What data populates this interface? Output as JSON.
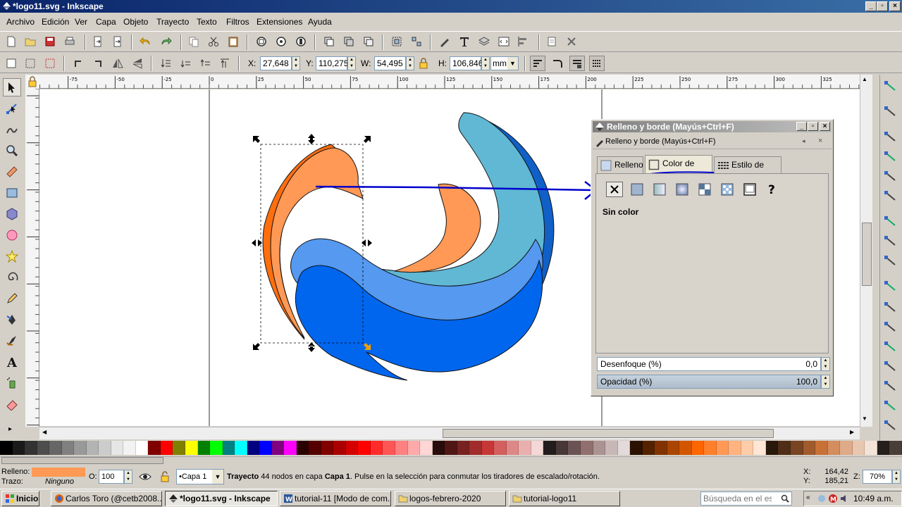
{
  "window": {
    "title": "*logo11.svg - Inkscape",
    "min": "_",
    "max": "▫",
    "close": "×"
  },
  "menu": [
    "Archivo",
    "Edición",
    "Ver",
    "Capa",
    "Objeto",
    "Trayecto",
    "Texto",
    "Filtros",
    "Extensiones",
    "Ayuda"
  ],
  "selector_toolbar": {
    "x_label": "X:",
    "x_value": "27,648",
    "y_label": "Y:",
    "y_value": "110,275",
    "w_label": "W:",
    "w_value": "54,495",
    "h_label": "H:",
    "h_value": "106,846",
    "unit": "mm"
  },
  "ruler_labels": [
    "-75",
    "-50",
    "-25",
    "0",
    "25",
    "50",
    "75",
    "100",
    "125",
    "150",
    "175",
    "200",
    "225",
    "250",
    "275",
    "300",
    "325"
  ],
  "dialog": {
    "title": "Relleno y borde (Mayús+Ctrl+F)",
    "subtitle": "Relleno y borde (Mayús+Ctrl+F)",
    "tabs": [
      "Relleno",
      "Color de trazo",
      "Estilo de trazo"
    ],
    "active_tab": "Color de trazo",
    "paint_mode_label": "Sin color",
    "blur_label": "Desenfoque (%)",
    "blur_value": "0,0",
    "opacity_label": "Opacidad (%)",
    "opacity_value": "100,0"
  },
  "status": {
    "fill_label": "Relleno:",
    "fill_color": "#ff9955",
    "stroke_label": "Trazo:",
    "stroke_value": "Ninguno",
    "opacity_label": "O:",
    "opacity_value": "100",
    "layer": "•Capa 1",
    "message_bold": "Trayecto",
    "message": " 44 nodos en capa ",
    "message_layer": "Capa 1",
    "message_tail": ". Pulse en la selección para conmutar los tiradores de escalado/rotación.",
    "x_label": "X:",
    "x_value": "164,42",
    "y_label": "Y:",
    "y_value": "185,21",
    "z_label": "Z:",
    "zoom": "70%"
  },
  "taskbar": {
    "start": "Inicio",
    "tasks": [
      "Carlos Toro (@cetb2008...",
      "*logo11.svg - Inkscape",
      "tutorial-11 [Modo de com...",
      "logos-febrero-2020",
      "tutorial-logo11"
    ],
    "search_placeholder": "Búsqueda en el escrito",
    "clock": "10:49 a.m."
  },
  "palette": [
    "#000000",
    "#1a1a1a",
    "#333333",
    "#4d4d4d",
    "#666666",
    "#808080",
    "#999999",
    "#b3b3b3",
    "#cccccc",
    "#e6e6e6",
    "#f2f2f2",
    "#ffffff",
    "#800000",
    "#ff0000",
    "#808000",
    "#ffff00",
    "#008000",
    "#00ff00",
    "#008080",
    "#00ffff",
    "#000080",
    "#0000ff",
    "#800080",
    "#ff00ff",
    "#2b0000",
    "#550000",
    "#800000",
    "#aa0000",
    "#d40000",
    "#ff0000",
    "#ff2a2a",
    "#ff5555",
    "#ff8080",
    "#ffaaaa",
    "#ffd5d5",
    "#280b0b",
    "#501616",
    "#782121",
    "#a02c2c",
    "#c83737",
    "#d35f5f",
    "#de8787",
    "#e9afaf",
    "#f4d7d7",
    "#241c1c",
    "#483737",
    "#6c5353",
    "#916f6f",
    "#ac9393",
    "#c8b7b7",
    "#e3dbdb",
    "#2b1100",
    "#552200",
    "#803300",
    "#aa4400",
    "#d45500",
    "#ff6600",
    "#ff7f2a",
    "#ff9955",
    "#ffb380",
    "#ffccaa",
    "#ffe6d5",
    "#28170b",
    "#502d16",
    "#784421",
    "#a05a2c",
    "#c87137",
    "#d38d5f",
    "#deaa87",
    "#e9c6af",
    "#f4e3d7",
    "#241f1c",
    "#483e37"
  ],
  "colors": {
    "accent_blue": "#0000cc",
    "title_blue": "#0a246a"
  }
}
